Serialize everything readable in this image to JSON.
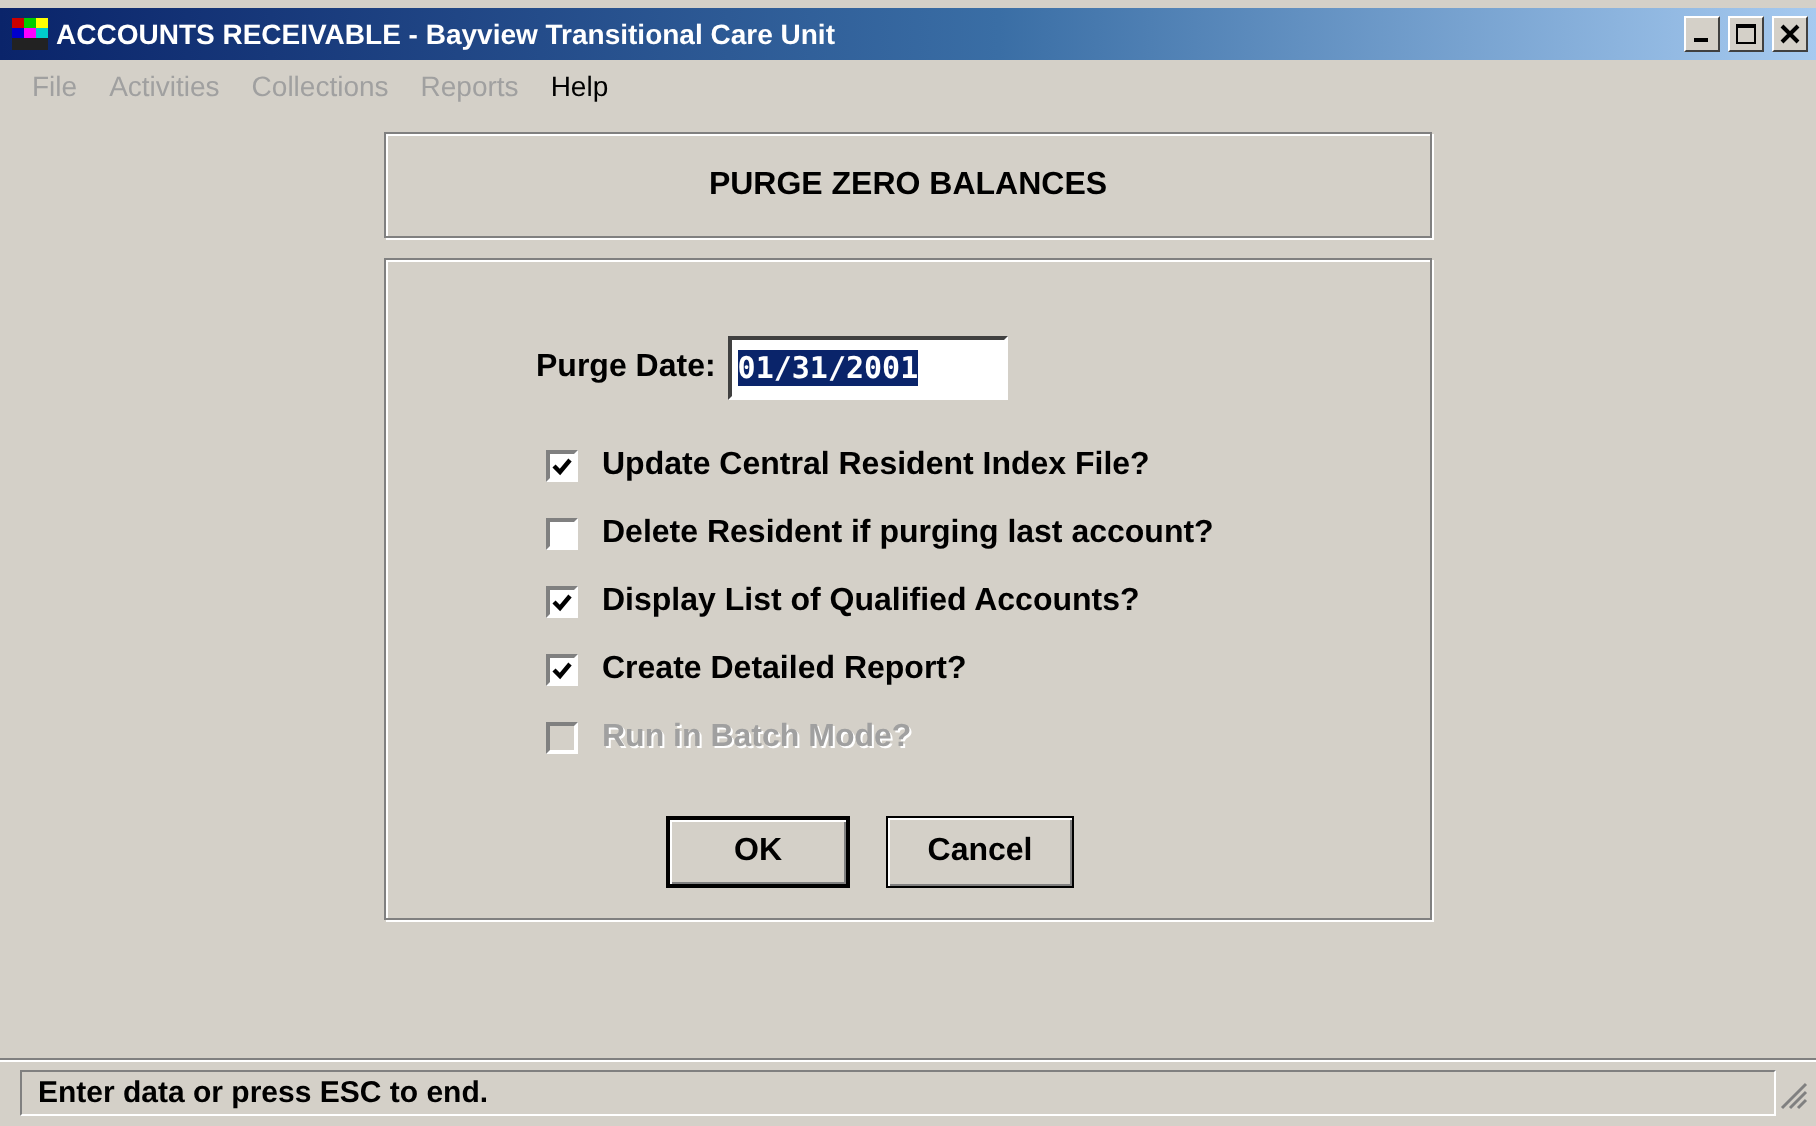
{
  "window": {
    "title": "ACCOUNTS RECEIVABLE - Bayview Transitional Care Unit"
  },
  "menu": [
    {
      "label": "File",
      "disabled": true
    },
    {
      "label": "Activities",
      "disabled": true
    },
    {
      "label": "Collections",
      "disabled": true
    },
    {
      "label": "Reports",
      "disabled": true
    },
    {
      "label": "Help",
      "disabled": false
    }
  ],
  "dialog_title": "PURGE ZERO BALANCES",
  "purge_date": {
    "label": "Purge Date:",
    "value": "01/31/2001",
    "text_selected": true
  },
  "options": [
    {
      "label": "Update Central Resident Index File?",
      "checked": true,
      "disabled": false
    },
    {
      "label": "Delete Resident if purging last account?",
      "checked": false,
      "disabled": false
    },
    {
      "label": "Display List of Qualified Accounts?",
      "checked": true,
      "disabled": false
    },
    {
      "label": "Create Detailed Report?",
      "checked": true,
      "disabled": false
    },
    {
      "label": "Run in Batch Mode?",
      "checked": false,
      "disabled": true
    }
  ],
  "buttons": [
    {
      "label": "OK",
      "default": true
    },
    {
      "label": "Cancel",
      "default": false
    }
  ],
  "status_bar": "Enter data or press ESC to end."
}
